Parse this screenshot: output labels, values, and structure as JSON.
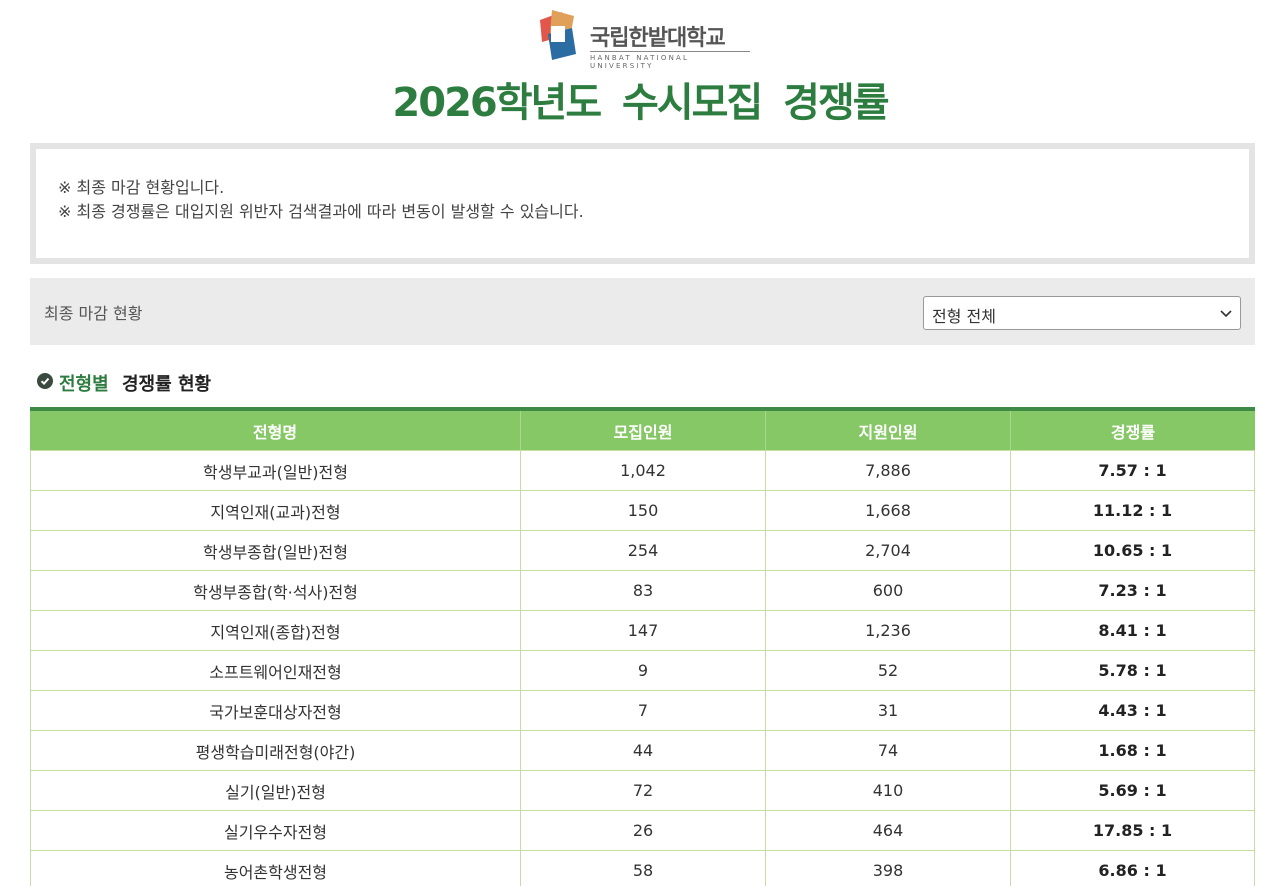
{
  "header": {
    "logo_name": "국립한밭대학교",
    "logo_subtitle": "HANBAT NATIONAL UNIVERSITY",
    "title": "2026학년도 수시모집 경쟁률"
  },
  "notice": {
    "line1": "※ 최종 마감 현황입니다.",
    "line2": "※ 최종 경쟁률은 대입지원 위반자 검색결과에 따라 변동이 발생할 수 있습니다."
  },
  "filter": {
    "label": "최종 마감 현황",
    "selected": "전형 전체"
  },
  "section": {
    "heading_highlight": "전형별",
    "heading_rest": "경쟁률 현황"
  },
  "table": {
    "headers": [
      "전형명",
      "모집인원",
      "지원인원",
      "경쟁률"
    ],
    "rows": [
      {
        "name": "학생부교과(일반)전형",
        "quota": "1,042",
        "applicants": "7,886",
        "ratio": "7.57 : 1"
      },
      {
        "name": "지역인재(교과)전형",
        "quota": "150",
        "applicants": "1,668",
        "ratio": "11.12 : 1"
      },
      {
        "name": "학생부종합(일반)전형",
        "quota": "254",
        "applicants": "2,704",
        "ratio": "10.65 : 1"
      },
      {
        "name": "학생부종합(학·석사)전형",
        "quota": "83",
        "applicants": "600",
        "ratio": "7.23 : 1"
      },
      {
        "name": "지역인재(종합)전형",
        "quota": "147",
        "applicants": "1,236",
        "ratio": "8.41 : 1"
      },
      {
        "name": "소프트웨어인재전형",
        "quota": "9",
        "applicants": "52",
        "ratio": "5.78 : 1"
      },
      {
        "name": "국가보훈대상자전형",
        "quota": "7",
        "applicants": "31",
        "ratio": "4.43 : 1"
      },
      {
        "name": "평생학습미래전형(야간)",
        "quota": "44",
        "applicants": "74",
        "ratio": "1.68 : 1"
      },
      {
        "name": "실기(일반)전형",
        "quota": "72",
        "applicants": "410",
        "ratio": "5.69 : 1"
      },
      {
        "name": "실기우수자전형",
        "quota": "26",
        "applicants": "464",
        "ratio": "17.85 : 1"
      },
      {
        "name": "농어촌학생전형",
        "quota": "58",
        "applicants": "398",
        "ratio": "6.86 : 1"
      }
    ]
  },
  "colors": {
    "brand_green": "#2c7d3f",
    "header_green": "#86c766",
    "logo_red": "#e2574c",
    "logo_orange": "#e0a05a",
    "logo_blue": "#2b6ca3"
  }
}
